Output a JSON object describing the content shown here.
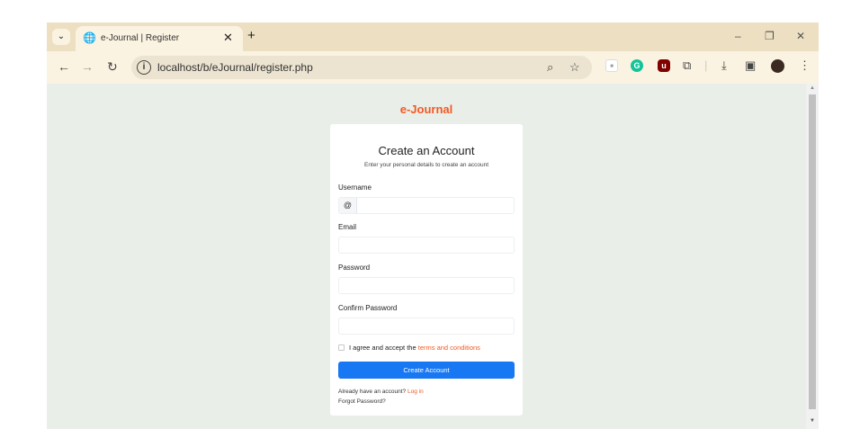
{
  "browser": {
    "tab_title": "e-Journal | Register",
    "url": "localhost/b/eJournal/register.php"
  },
  "colors": {
    "accent": "#f15a24",
    "primary_button": "#1877f2",
    "tabstrip": "#ede0c2",
    "page_background": "#eaeee9"
  },
  "icons": {
    "tab_search": "chevron-down-icon",
    "favicon": "globe-icon",
    "site_info": "info-icon",
    "zoom": "zoom-icon",
    "bookmark": "star-icon",
    "extensions": [
      "extension-square-icon",
      "grammarly-icon",
      "ublock-icon",
      "puzzle-icon"
    ],
    "download": "download-icon",
    "side_panel": "side-panel-icon",
    "profile": "avatar",
    "menu": "kebab-menu-icon"
  },
  "page": {
    "brand": "e-Journal",
    "form": {
      "title": "Create an Account",
      "subtitle": "Enter your personal details to create an account",
      "username_label": "Username",
      "username_prefix": "@",
      "username_value": "",
      "email_label": "Email",
      "email_value": "",
      "password_label": "Password",
      "password_value": "",
      "confirm_label": "Confirm Password",
      "confirm_value": "",
      "terms_prefix": "I agree and accept the",
      "terms_link": "terms and conditions",
      "terms_checked": false,
      "submit_label": "Create Account",
      "login_prefix": "Already have an account?",
      "login_link": "Log in",
      "forgot_link": "Forgot Password?"
    }
  }
}
